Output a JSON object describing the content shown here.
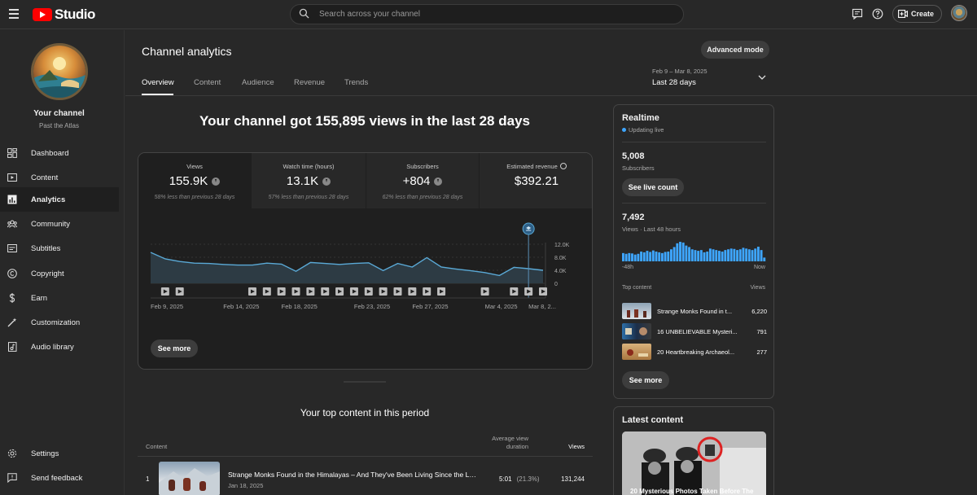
{
  "app": {
    "name": "Studio",
    "brand_color": "#ff0000"
  },
  "search": {
    "placeholder": "Search across your channel"
  },
  "header": {
    "create_label": "Create"
  },
  "sidebar": {
    "channel_title": "Your channel",
    "channel_name": "Past the Atlas",
    "items": [
      {
        "label": "Dashboard",
        "icon": "dashboard-icon"
      },
      {
        "label": "Content",
        "icon": "content-icon"
      },
      {
        "label": "Analytics",
        "icon": "analytics-icon",
        "active": true
      },
      {
        "label": "Community",
        "icon": "community-icon"
      },
      {
        "label": "Subtitles",
        "icon": "subtitles-icon"
      },
      {
        "label": "Copyright",
        "icon": "copyright-icon"
      },
      {
        "label": "Earn",
        "icon": "earn-icon"
      },
      {
        "label": "Customization",
        "icon": "customization-icon"
      },
      {
        "label": "Audio library",
        "icon": "audio-library-icon"
      }
    ],
    "bottom_items": [
      {
        "label": "Settings",
        "icon": "settings-icon"
      },
      {
        "label": "Send feedback",
        "icon": "feedback-icon"
      }
    ]
  },
  "main": {
    "title": "Channel analytics",
    "advanced_label": "Advanced mode",
    "tabs": [
      "Overview",
      "Content",
      "Audience",
      "Revenue",
      "Trends"
    ],
    "date_range": {
      "dates": "Feb 9 – Mar 8, 2025",
      "label": "Last 28 days"
    },
    "headline": "Your channel got 155,895 views in the last 28 days",
    "metrics": [
      {
        "label": "Views",
        "value": "155.9K",
        "compare": "58% less than previous 28 days"
      },
      {
        "label": "Watch time (hours)",
        "value": "13.1K",
        "compare": "57% less than previous 28 days"
      },
      {
        "label": "Subscribers",
        "value": "+804",
        "compare": "62% less than previous 28 days"
      },
      {
        "label": "Estimated revenue",
        "value": "$392.21",
        "compare": ""
      }
    ],
    "see_more_label": "See more",
    "top_content": {
      "title": "Your top content in this period",
      "col_content": "Content",
      "col_avd_line1": "Average view",
      "col_avd_line2": "duration",
      "col_views": "Views",
      "rows": [
        {
          "rank": "1",
          "title": "Strange Monks Found in the Himalayas – And They've Been Living Since the Last...",
          "date": "Jan 18, 2025",
          "duration": "5:01",
          "duration_pct": "(21.3%)",
          "views": "131,244"
        }
      ]
    }
  },
  "chart_data": {
    "type": "line",
    "x": [
      "Feb 9",
      "Feb 10",
      "Feb 11",
      "Feb 12",
      "Feb 13",
      "Feb 14",
      "Feb 15",
      "Feb 16",
      "Feb 17",
      "Feb 18",
      "Feb 19",
      "Feb 20",
      "Feb 21",
      "Feb 22",
      "Feb 23",
      "Feb 24",
      "Feb 25",
      "Feb 26",
      "Feb 27",
      "Feb 28",
      "Mar 1",
      "Mar 2",
      "Mar 3",
      "Mar 4",
      "Mar 5",
      "Mar 6",
      "Mar 7",
      "Mar 8"
    ],
    "series": [
      {
        "values": [
          9500,
          7500,
          6700,
          6200,
          6100,
          5800,
          5600,
          5600,
          6200,
          5900,
          3700,
          6400,
          6100,
          5800,
          6100,
          6300,
          3900,
          6100,
          5000,
          7900,
          5000,
          4400,
          3900,
          3300,
          2400,
          4900,
          4500,
          4000
        ]
      }
    ],
    "x_tick_labels": [
      "Feb 9, 2025",
      "Feb 14, 2025",
      "Feb 18, 2025",
      "Feb 23, 2025",
      "Feb 27, 2025",
      "Mar 4, 2025",
      "Mar 8, 2..."
    ],
    "y_tick_labels": [
      "12.0K",
      "8.0K",
      "4.0K",
      "0"
    ],
    "ylim": [
      0,
      12000
    ],
    "video_marker_days": [
      1,
      2,
      7,
      8,
      9,
      10,
      11,
      12,
      13,
      14,
      15,
      16,
      17,
      18,
      19,
      20,
      23,
      25,
      26,
      27
    ],
    "highlight_day": 26,
    "line_color": "#5aa9d6",
    "grid": true
  },
  "realtime": {
    "title": "Realtime",
    "status": "Updating live",
    "subscribers_value": "5,008",
    "subscribers_label": "Subscribers",
    "see_live_label": "See live count",
    "views_value": "7,492",
    "views_label": "Views · Last 48 hours",
    "axis_start": "-48h",
    "axis_end": "Now",
    "bar_color": "#3ea6ff",
    "hourly_views": [
      110,
      100,
      110,
      105,
      90,
      100,
      130,
      120,
      140,
      125,
      145,
      130,
      120,
      110,
      125,
      130,
      160,
      190,
      240,
      260,
      250,
      210,
      190,
      160,
      150,
      140,
      150,
      120,
      130,
      170,
      160,
      150,
      140,
      130,
      150,
      160,
      170,
      165,
      150,
      160,
      180,
      170,
      160,
      150,
      170,
      195,
      150,
      50
    ],
    "top_content_label": "Top content",
    "views_col_label": "Views",
    "top_items": [
      {
        "title": "Strange Monks Found in t...",
        "views": "6,220"
      },
      {
        "title": "16 UNBELIEVABLE Mysteri...",
        "views": "791"
      },
      {
        "title": "20 Heartbreaking Archaeol...",
        "views": "277"
      }
    ],
    "see_more_label": "See more"
  },
  "latest_content": {
    "title": "Latest content",
    "video_title": "20 Mysterious Photos Taken Before The"
  }
}
